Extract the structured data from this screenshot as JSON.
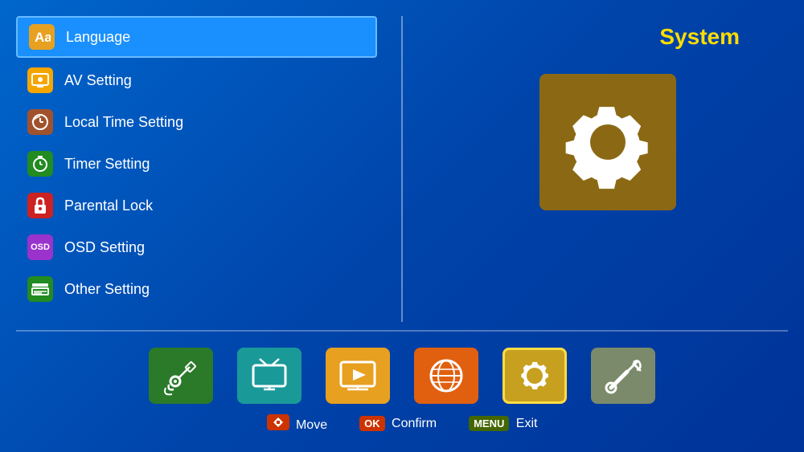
{
  "header": {
    "title": "System"
  },
  "menu": {
    "items": [
      {
        "id": "language",
        "label": "Language",
        "icon_type": "language",
        "selected": true
      },
      {
        "id": "av-setting",
        "label": "AV Setting",
        "icon_type": "av",
        "selected": false
      },
      {
        "id": "local-time",
        "label": "Local Time Setting",
        "icon_type": "time",
        "selected": false
      },
      {
        "id": "timer",
        "label": "Timer Setting",
        "icon_type": "timer",
        "selected": false
      },
      {
        "id": "parental",
        "label": "Parental Lock",
        "icon_type": "parental",
        "selected": false
      },
      {
        "id": "osd",
        "label": "OSD Setting",
        "icon_type": "osd",
        "selected": false
      },
      {
        "id": "other",
        "label": "Other Setting",
        "icon_type": "other",
        "selected": false
      }
    ]
  },
  "bottom_nav": {
    "items": [
      {
        "id": "satellite",
        "label": "Satellite",
        "icon_type": "satellite"
      },
      {
        "id": "tv",
        "label": "TV",
        "icon_type": "tv"
      },
      {
        "id": "media",
        "label": "Media Player",
        "icon_type": "media"
      },
      {
        "id": "globe",
        "label": "Network",
        "icon_type": "globe"
      },
      {
        "id": "system",
        "label": "System",
        "icon_type": "system",
        "active": true
      },
      {
        "id": "tools",
        "label": "Tools",
        "icon_type": "tools"
      }
    ]
  },
  "status_bar": {
    "move_badge": "◆",
    "move_label": "Move",
    "ok_badge": "OK",
    "ok_label": "Confirm",
    "menu_badge": "MENU",
    "menu_label": "Exit"
  }
}
